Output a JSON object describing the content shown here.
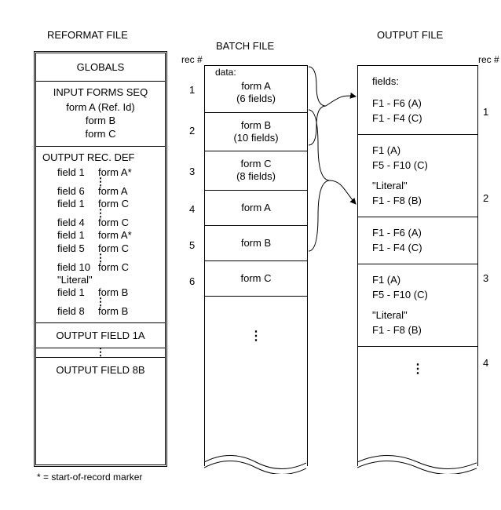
{
  "titles": {
    "reformat": "REFORMAT FILE",
    "batch": "BATCH FILE",
    "output": "OUTPUT FILE",
    "rec_left": "rec #",
    "rec_right": "rec #",
    "data_label": "data:",
    "fields_label": "fields:"
  },
  "reformat": {
    "globals": "GLOBALS",
    "seq": {
      "title": "INPUT FORMS SEQ",
      "lines": [
        "form A (Ref. Id)",
        "form B",
        "form C"
      ]
    },
    "def": {
      "title": "OUTPUT REC. DEF",
      "group1": [
        [
          "field 1",
          "form A*"
        ]
      ],
      "group2": [
        [
          "field 6",
          "form A"
        ],
        [
          "field 1",
          "form C"
        ]
      ],
      "group3": [
        [
          "field 4",
          "form C"
        ],
        [
          "field 1",
          "form A*"
        ],
        [
          "field 5",
          "form C"
        ]
      ],
      "group4": [
        [
          "field 10",
          "form C"
        ],
        [
          "\"Literal\"",
          ""
        ],
        [
          "field 1",
          "form B"
        ]
      ],
      "group5": [
        [
          "field 8",
          "form B"
        ]
      ]
    },
    "out1": "OUTPUT FIELD 1A",
    "out8": "OUTPUT FIELD 8B"
  },
  "batch": {
    "rows": [
      {
        "n": "1",
        "l1": "form A",
        "l2": "(6 fields)"
      },
      {
        "n": "2",
        "l1": "form B",
        "l2": "(10 fields)"
      },
      {
        "n": "3",
        "l1": "form C",
        "l2": "(8 fields)"
      },
      {
        "n": "4",
        "l1": "form A",
        "l2": ""
      },
      {
        "n": "5",
        "l1": "form B",
        "l2": ""
      },
      {
        "n": "6",
        "l1": "form C",
        "l2": ""
      }
    ]
  },
  "output": {
    "rows": [
      {
        "n": "1",
        "lines": [
          "F1 - F6 (A)",
          "F1 - F4 (C)"
        ]
      },
      {
        "n": "2",
        "lines": [
          "F1 (A)",
          "F5 - F10 (C)",
          "",
          "\"Literal\"",
          "F1 - F8 (B)"
        ]
      },
      {
        "n": "3",
        "lines": [
          "F1 - F6 (A)",
          "F1 - F4 (C)"
        ]
      },
      {
        "n": "4",
        "lines": [
          "F1 (A)",
          "F5 - F10 (C)",
          "",
          "\"Literal\"",
          "F1 - F8 (B)"
        ]
      }
    ]
  },
  "footnote": "* = start-of-record marker"
}
